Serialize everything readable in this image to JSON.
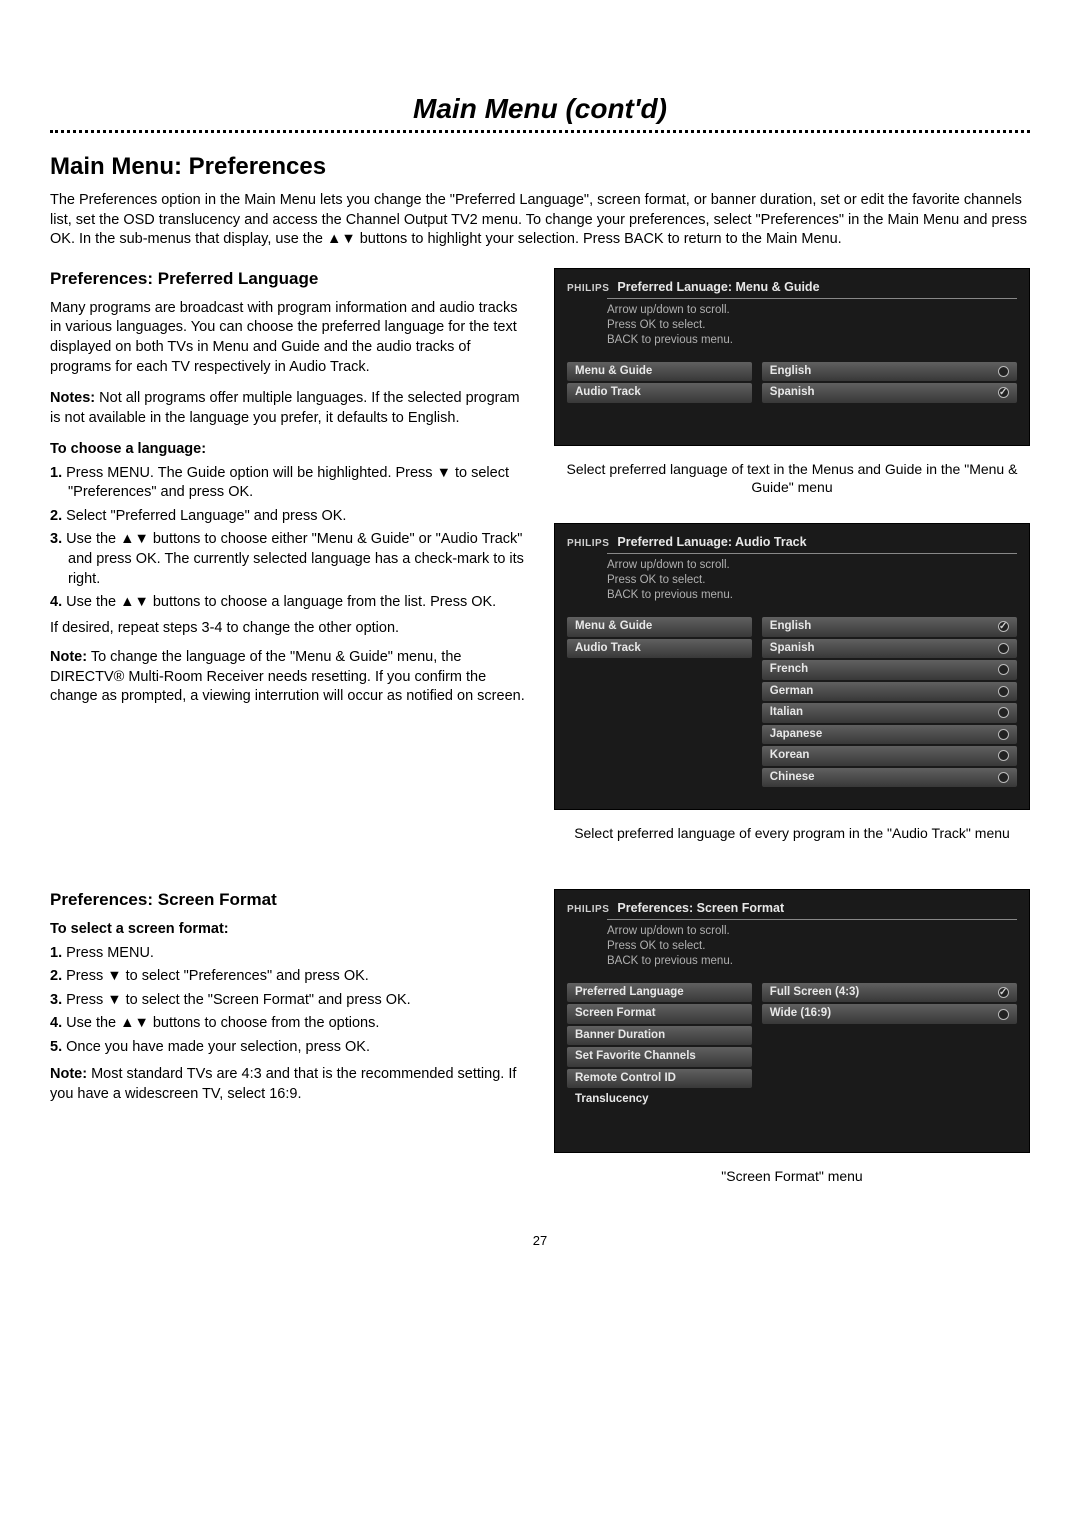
{
  "page": {
    "main_title": "Main Menu (cont'd)",
    "section_title": "Main Menu: Preferences",
    "intro": "The Preferences option in the Main Menu lets you change the \"Preferred Language\", screen format, or banner duration, set or edit the favorite channels list, set the OSD translucency and access the Channel Output TV2 menu. To change your preferences, select \"Preferences\" in the Main Menu and press OK. In the sub-menus that display, use the ▲▼ buttons to highlight your selection. Press BACK to return to the Main Menu.",
    "page_num": "27"
  },
  "lang_section": {
    "title": "Preferences: Preferred Language",
    "p1": "Many programs are broadcast with program information and audio tracks in various languages. You can choose the preferred language for the text displayed on both TVs in Menu and Guide and the audio tracks of programs for each TV respectively in Audio Track.",
    "notes_label": "Notes:",
    "notes_text": " Not all programs offer multiple languages. If the selected program is not available in the language you prefer, it defaults to English.",
    "to_choose": "To choose a language:",
    "steps": [
      "Press MENU. The Guide option will be highlighted. Press ▼ to select \"Preferences\" and press OK.",
      "Select \"Preferred Language\" and press OK.",
      "Use the ▲▼ buttons to choose either \"Menu & Guide\" or \"Audio Track\" and press OK. The currently selected language has a check-mark to its right.",
      "Use the ▲▼ buttons to choose a language from the list. Press OK."
    ],
    "repeat": "If desired, repeat steps 3-4 to change the other option.",
    "note2_label": "Note:",
    "note2_text": " To change the language of the \"Menu & Guide\" menu, the DIRECTV® Multi-Room Receiver needs resetting. If you confirm the change as prompted, a viewing interrution will occur as notified on screen."
  },
  "screen1": {
    "brand": "PHILIPS",
    "title": "Preferred Lanuage: Menu & Guide",
    "instr1": "Arrow up/down to scroll.",
    "instr2": "Press OK to select.",
    "instr3": "BACK to previous menu.",
    "left_items": [
      "Menu & Guide",
      "Audio Track"
    ],
    "right_items": [
      {
        "label": "English",
        "checked": false
      },
      {
        "label": "Spanish",
        "checked": true
      }
    ],
    "caption": "Select preferred language of text in the Menus and Guide in the \"Menu & Guide\" menu"
  },
  "screen2": {
    "brand": "PHILIPS",
    "title": "Preferred Lanuage: Audio Track",
    "instr1": "Arrow up/down to scroll.",
    "instr2": "Press OK to select.",
    "instr3": "BACK to previous menu.",
    "left_items": [
      "Menu & Guide",
      "Audio Track"
    ],
    "right_items": [
      {
        "label": "English",
        "checked": true
      },
      {
        "label": "Spanish",
        "checked": false
      },
      {
        "label": "French",
        "checked": false
      },
      {
        "label": "German",
        "checked": false
      },
      {
        "label": "Italian",
        "checked": false
      },
      {
        "label": "Japanese",
        "checked": false
      },
      {
        "label": "Korean",
        "checked": false
      },
      {
        "label": "Chinese",
        "checked": false
      }
    ],
    "caption": "Select preferred language of every program in the \"Audio Track\" menu"
  },
  "format_section": {
    "title": "Preferences: Screen Format",
    "to_select": "To select a screen format:",
    "steps": [
      "Press MENU.",
      "Press ▼ to select \"Preferences\" and press OK.",
      "Press ▼ to select the \"Screen Format\" and press OK.",
      "Use the ▲▼ buttons to choose from the options.",
      "Once you have made your selection, press OK."
    ],
    "note_label": "Note:",
    "note_text": " Most standard TVs are 4:3 and that is the recommended setting. If you have a widescreen TV, select 16:9."
  },
  "screen3": {
    "brand": "PHILIPS",
    "title": "Preferences: Screen Format",
    "instr1": "Arrow up/down to scroll.",
    "instr2": "Press OK to select.",
    "instr3": "BACK to previous menu.",
    "left_items": [
      "Preferred Language",
      "Screen Format",
      "Banner Duration",
      "Set Favorite Channels",
      "Remote Control ID",
      "Translucency"
    ],
    "right_items": [
      {
        "label": "Full Screen (4:3)",
        "checked": true
      },
      {
        "label": "Wide (16:9)",
        "checked": false
      }
    ],
    "caption": "\"Screen Format\" menu"
  }
}
